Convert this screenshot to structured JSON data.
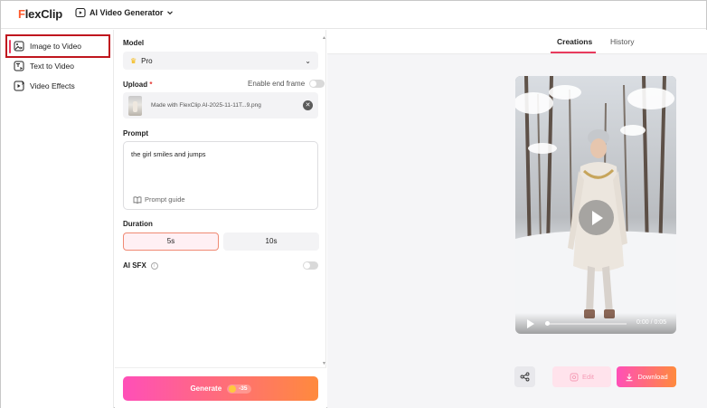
{
  "header": {
    "logo_mark": "F",
    "logo_text": "lexClip",
    "tool_label": "AI Video Generator"
  },
  "nav": {
    "items": [
      {
        "label": "Image to Video",
        "active": true,
        "icon": "image-video-icon"
      },
      {
        "label": "Text to Video",
        "active": false,
        "icon": "text-video-icon"
      },
      {
        "label": "Video Effects",
        "active": false,
        "icon": "video-effects-icon"
      }
    ]
  },
  "settings": {
    "model_label": "Model",
    "model_value": "Pro",
    "upload_label": "Upload",
    "upload_required_mark": "*",
    "end_frame_label": "Enable end frame",
    "end_frame_enabled": false,
    "file_name": "Made with FlexClip AI-2025-11-11T...9.png",
    "prompt_label": "Prompt",
    "prompt_value": "the girl smiles and jumps",
    "prompt_guide": "Prompt guide",
    "duration_label": "Duration",
    "durations": [
      "5s",
      "10s"
    ],
    "duration_selected": "5s",
    "sfx_label": "AI SFX",
    "sfx_enabled": false,
    "generate_label": "Generate",
    "generate_cost": "-35"
  },
  "preview": {
    "tabs": [
      "Creations",
      "History"
    ],
    "active_tab": "Creations",
    "time": "0:00 / 0:05",
    "edit_label": "Edit",
    "download_label": "Download"
  },
  "colors": {
    "accent": "#e83a5d",
    "gradient_start": "#ff4fb8",
    "gradient_end": "#ff8a3d",
    "highlight_box": "#c0161e"
  }
}
